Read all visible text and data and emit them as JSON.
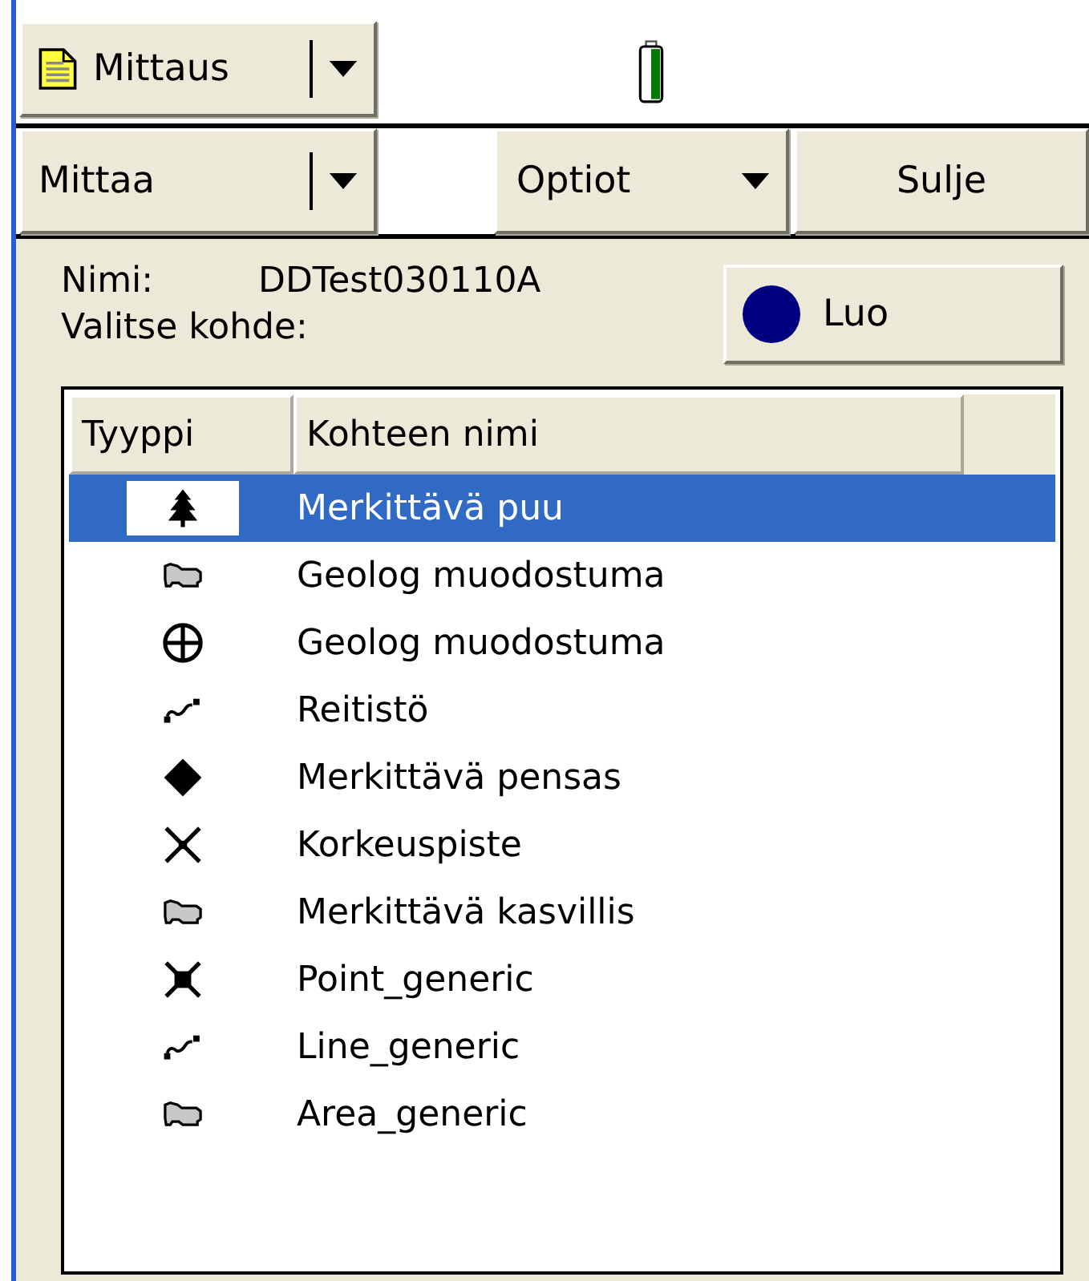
{
  "top_menu": {
    "label": "Mittaus"
  },
  "toolbar": {
    "measure": {
      "label": "Mittaa"
    },
    "options": {
      "label": "Optiot"
    },
    "close": {
      "label": "Sulje"
    }
  },
  "form": {
    "name_label": "Nimi:",
    "name_value": "DDTest030110A",
    "select_label": "Valitse kohde:",
    "create_button": "Luo"
  },
  "table": {
    "columns": [
      "Tyyppi",
      "Kohteen nimi"
    ],
    "rows": [
      {
        "kind": "tree",
        "name": "Merkittävä puu",
        "selected": true
      },
      {
        "kind": "area",
        "name": "Geolog muodostuma",
        "selected": false
      },
      {
        "kind": "crosshair",
        "name": "Geolog muodostuma",
        "selected": false
      },
      {
        "kind": "line",
        "name": "Reitistö",
        "selected": false
      },
      {
        "kind": "diamond",
        "name": "Merkittävä pensas",
        "selected": false
      },
      {
        "kind": "cross",
        "name": "Korkeuspiste",
        "selected": false
      },
      {
        "kind": "area",
        "name": "Merkittävä kasvillis",
        "selected": false
      },
      {
        "kind": "point",
        "name": "Point_generic",
        "selected": false
      },
      {
        "kind": "line",
        "name": "Line_generic",
        "selected": false
      },
      {
        "kind": "area",
        "name": "Area_generic",
        "selected": false
      }
    ]
  }
}
